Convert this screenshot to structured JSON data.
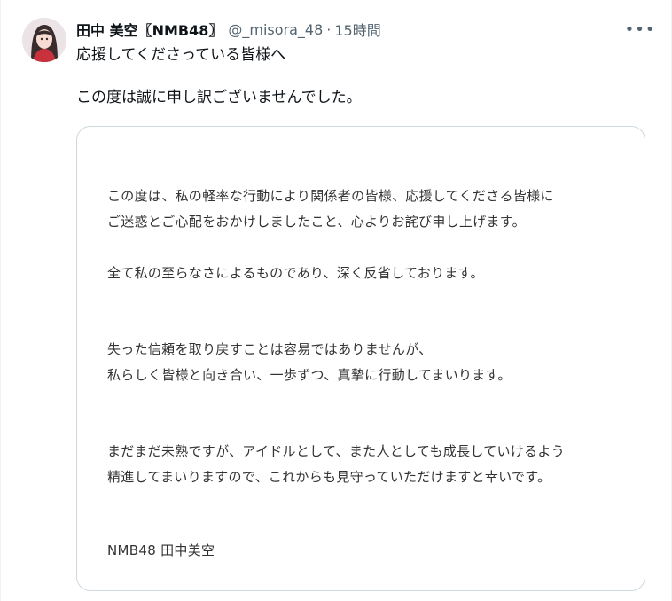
{
  "author": {
    "display_name": "田中 美空〖NMB48〗",
    "handle": "@_misora_48",
    "separator": "·",
    "time": "15時間",
    "avatar_icon": "user-avatar-photo"
  },
  "more_icon": "more-horizontal-icon",
  "more_label": "•••",
  "tweet": {
    "line1": "応援してくださっている皆様へ",
    "line2": "この度は誠に申し訳ございませんでした。"
  },
  "statement": {
    "p1_l1": "この度は、私の軽率な行動により関係者の皆様、応援してくださる皆様に",
    "p1_l2": "ご迷惑とご心配をおかけしましたこと、心よりお詫び申し上げます。",
    "p2": "全て私の至らなさによるものであり、深く反省しております。",
    "p3_l1": "失った信頼を取り戻すことは容易ではありませんが、",
    "p3_l2": "私らしく皆様と向き合い、一歩ずつ、真摯に行動してまいります。",
    "p4_l1": "まだまだ未熟ですが、アイドルとして、また人としても成長していけるよう",
    "p4_l2": "精進してまいりますので、これからも見守っていただけますと幸いです。",
    "signature": "NMB48 田中美空"
  },
  "colors": {
    "text": "#0f1419",
    "secondary": "#536471",
    "border": "#cfd9de",
    "statement_text": "#333333"
  }
}
